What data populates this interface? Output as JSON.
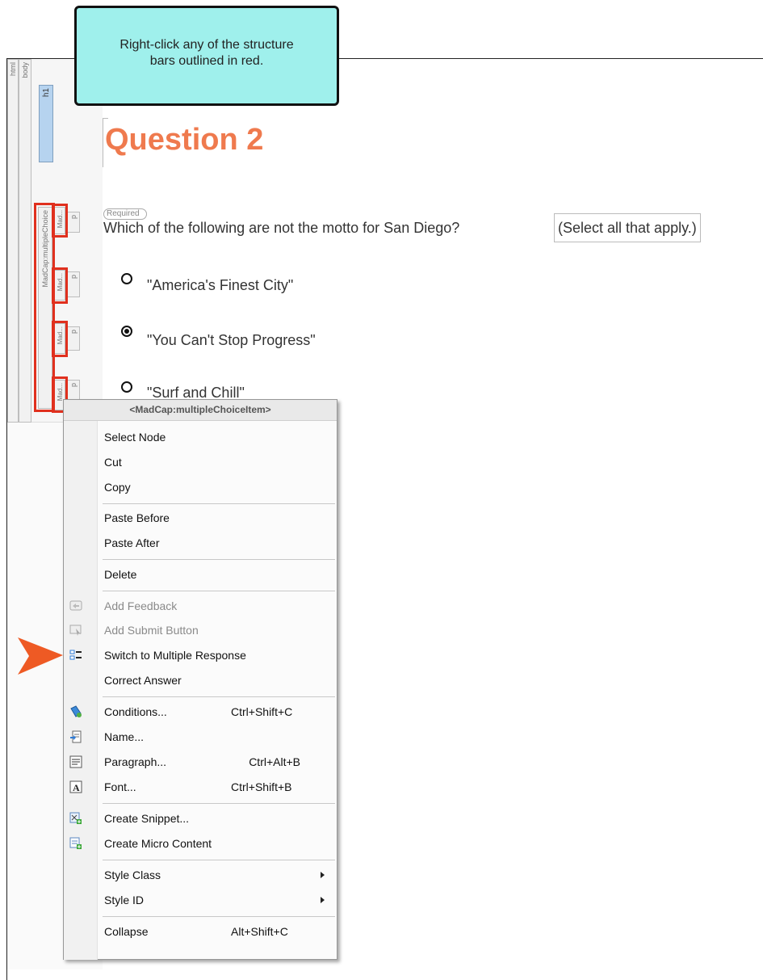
{
  "callout": {
    "line1": "Right-click any of the structure",
    "line2": "bars outlined in red."
  },
  "structure_bars": {
    "html": "html",
    "body": "body",
    "h1": "h1",
    "multiple_choice": "MadCap:multipleChoice",
    "items": [
      {
        "item": "Mad...",
        "p": "p"
      },
      {
        "item": "Mad...",
        "p": "p"
      },
      {
        "item": "Mad...",
        "p": "p"
      },
      {
        "item": "Mad...",
        "p": "p"
      }
    ]
  },
  "content": {
    "heading": "Question 2",
    "required_tag": "Required",
    "question": "Which of the following are not the motto for San Diego?",
    "hint": "(Select all that apply.)",
    "answers": [
      {
        "text": "\"America's Finest City\"",
        "selected": false
      },
      {
        "text": "\"You Can't Stop Progress\"",
        "selected": true
      },
      {
        "text": "\"Surf and Chill\"",
        "selected": false
      }
    ]
  },
  "context_menu": {
    "header": "<MadCap:multipleChoiceItem>",
    "items": [
      {
        "label": "Select Node",
        "enabled": true
      },
      {
        "label": "Cut",
        "enabled": true
      },
      {
        "label": "Copy",
        "enabled": true
      },
      {
        "label": "Paste Before",
        "enabled": true
      },
      {
        "label": "Paste After",
        "enabled": true
      },
      {
        "label": "Delete",
        "enabled": true
      },
      {
        "label": "Add Feedback",
        "enabled": false,
        "icon": "feedback-icon"
      },
      {
        "label": "Add Submit Button",
        "enabled": false,
        "icon": "submit-button-icon"
      },
      {
        "label": "Switch to Multiple Response",
        "enabled": true,
        "icon": "multiple-response-icon"
      },
      {
        "label": "Correct Answer",
        "enabled": true
      },
      {
        "label": "Conditions...",
        "shortcut": "Ctrl+Shift+C",
        "enabled": true,
        "icon": "conditions-icon"
      },
      {
        "label": "Name...",
        "enabled": true,
        "icon": "name-icon"
      },
      {
        "label": "Paragraph...",
        "shortcut": "Ctrl+Alt+B",
        "enabled": true,
        "icon": "paragraph-icon"
      },
      {
        "label": "Font...",
        "shortcut": "Ctrl+Shift+B",
        "enabled": true,
        "icon": "font-icon"
      },
      {
        "label": "Create Snippet...",
        "enabled": true,
        "icon": "snippet-icon"
      },
      {
        "label": "Create Micro Content",
        "enabled": true,
        "icon": "micro-content-icon"
      },
      {
        "label": "Style Class",
        "enabled": true,
        "submenu": true
      },
      {
        "label": "Style ID",
        "enabled": true,
        "submenu": true
      },
      {
        "label": "Collapse",
        "shortcut": "Alt+Shift+C",
        "enabled": true
      }
    ]
  },
  "colors": {
    "callout_bg": "#9ff0ec",
    "heading": "#ef7a4e",
    "outline_red": "#e0301e",
    "pointer_arrow": "#ee5a24"
  }
}
